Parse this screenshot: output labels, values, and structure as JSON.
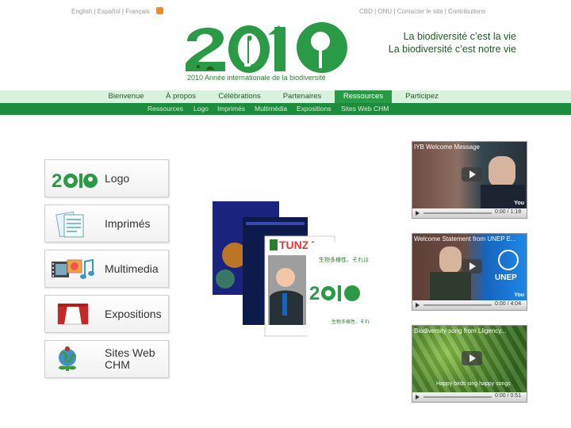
{
  "top_bar": {
    "languages": "English | Español | Français",
    "links": "CBD | ONU | Contacter le site | Contributions"
  },
  "logo": {
    "caption": "2010 Année internationale de la biodiversité"
  },
  "slogan": {
    "line1": "La biodiversité c’est la vie",
    "line2": "La biodiversité c’est notre vie"
  },
  "nav": {
    "main": [
      "Bienvenue",
      "À propos",
      "Célébrations",
      "Partenaires",
      "Ressources",
      "Participez"
    ],
    "active": "Ressources",
    "sub": [
      "Ressources",
      "Logo",
      "Imprimés",
      "Multimédia",
      "Expositions",
      "Sites Web CHM"
    ]
  },
  "menu": [
    {
      "label": "Logo",
      "icon": "logo-2010-icon"
    },
    {
      "label": "Imprimés",
      "icon": "documents-icon"
    },
    {
      "label": "Multimedia",
      "icon": "multimedia-icon"
    },
    {
      "label": "Expositions",
      "icon": "exhibition-stage-icon"
    },
    {
      "label": "Sites Web CHM",
      "icon": "globe-plant-icon"
    }
  ],
  "collage": {
    "tunza": "TUNZA",
    "japanese1": "生物多様性、それはいのち",
    "japanese2": "生物多様性、それは私たちの暮らし"
  },
  "videos": [
    {
      "title": "IYB Welcome Message",
      "time": "0:00 / 1:18",
      "overlay": ""
    },
    {
      "title": "Welcome Statement from UNEP E...",
      "time": "0:00 / 4:04",
      "overlay": "UNEP"
    },
    {
      "title": "Biodiversity song from Lligency...",
      "time": "0:00 / 0:51",
      "overlay": "Happy birds sing happy songs"
    }
  ],
  "colors": {
    "brand_green": "#2a9a47",
    "dark_green": "#1e8c3d",
    "nav_bg": "#d9f2df"
  }
}
